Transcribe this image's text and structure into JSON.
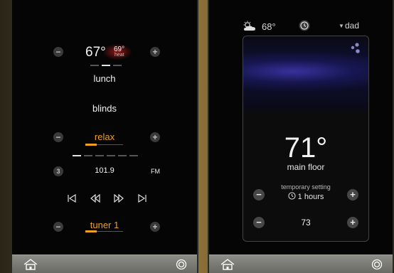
{
  "left_panel": {
    "thermostat": {
      "current_temp": "67°",
      "setpoint": "69°",
      "mode": "heat"
    },
    "scene": "lunch",
    "shades": "blinds",
    "music_source": {
      "label": "relax",
      "level": 0.3
    },
    "radio": {
      "preset_number": "3",
      "frequency": "101.9",
      "band": "FM"
    },
    "zone_source": {
      "label": "tuner 1",
      "level": 0.3
    },
    "buttons": {
      "minus": "−",
      "plus": "+"
    }
  },
  "right_panel": {
    "weather": {
      "outdoor_temp": "68°",
      "icon": "partly-cloudy-icon"
    },
    "user": {
      "name": "dad"
    },
    "thermostat": {
      "temperature": "71°",
      "zone": "main floor",
      "hold_label": "temporary setting",
      "duration": "1 hours",
      "setpoint": "73"
    },
    "buttons": {
      "minus": "−",
      "plus": "+"
    }
  },
  "colors": {
    "accent": "#f0a01e",
    "background": "#050505",
    "bar": "#7c7c77",
    "wave": "#4636be"
  }
}
